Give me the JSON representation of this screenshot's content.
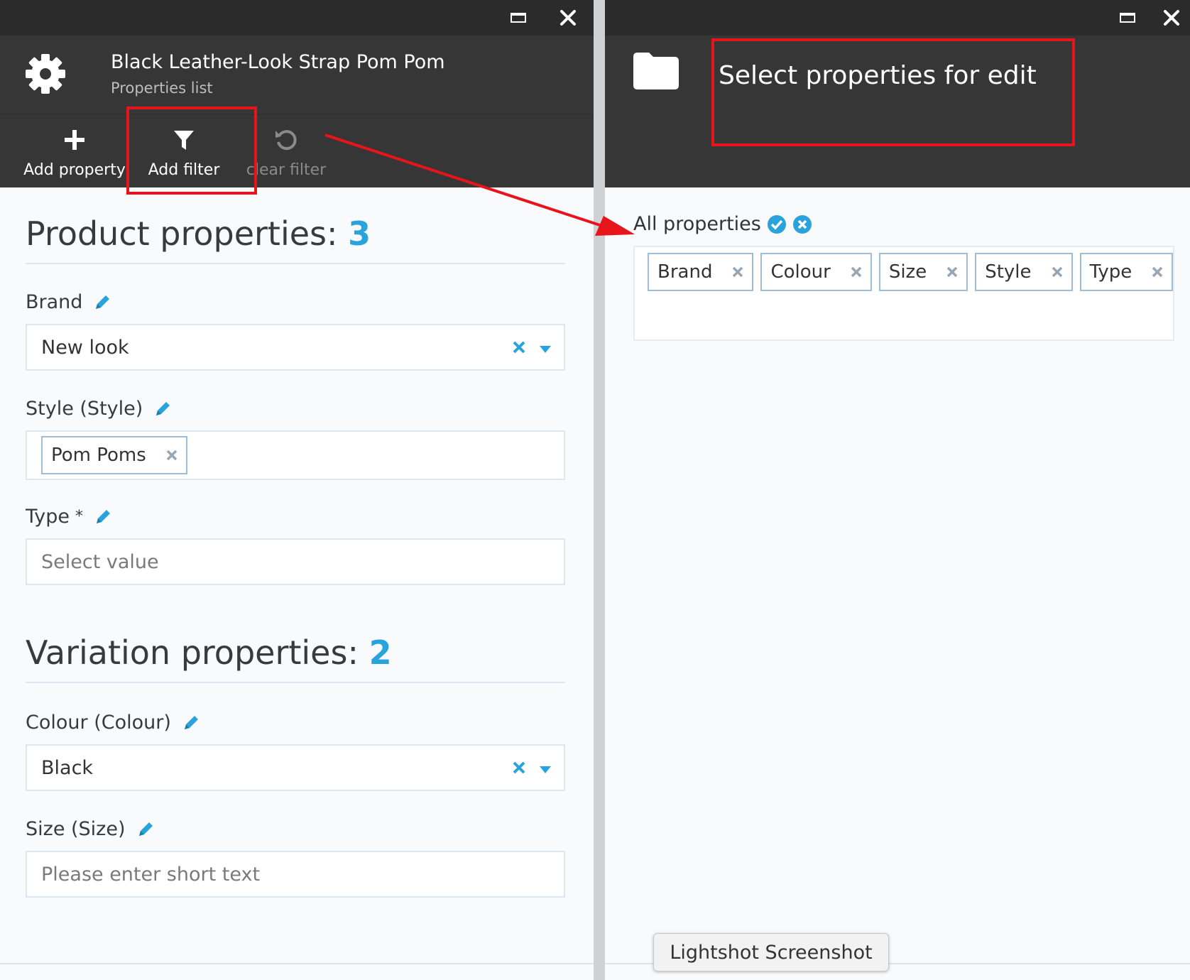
{
  "left": {
    "title": "Black Leather-Look Strap Pom Pom",
    "subtitle": "Properties list",
    "toolbar": {
      "add_property": "Add property",
      "add_filter": "Add filter",
      "clear_filter": "clear filter"
    },
    "product_section": {
      "title": "Product properties:",
      "count": "3"
    },
    "variation_section": {
      "title": "Variation properties:",
      "count": "2"
    },
    "fields": {
      "brand": {
        "label": "Brand",
        "value": "New look"
      },
      "style": {
        "label": "Style (Style)",
        "tag": "Pom Poms"
      },
      "type": {
        "label": "Type",
        "required": "*",
        "placeholder": "Select value"
      },
      "colour": {
        "label": "Colour (Colour)",
        "value": "Black"
      },
      "size": {
        "label": "Size (Size)",
        "placeholder": "Please enter short text"
      }
    }
  },
  "right": {
    "title": "Select properties for edit",
    "all_properties_label": "All properties",
    "tags": [
      "Brand",
      "Colour",
      "Size",
      "Style",
      "Type"
    ]
  },
  "tooltip": "Lightshot Screenshot",
  "colors": {
    "accent": "#2aa3dc",
    "header": "#363636",
    "topbar": "#2b2b2b",
    "annotation": "#e8141c"
  }
}
